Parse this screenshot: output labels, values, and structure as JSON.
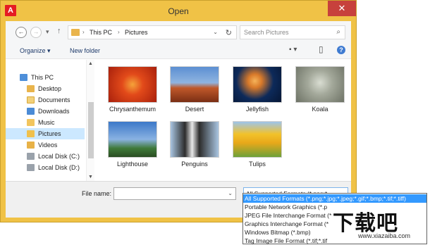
{
  "window": {
    "title": "Open",
    "app_icon_glyph": "A",
    "close_glyph": "✕",
    "titlebar_color": "#f0c246"
  },
  "nav": {
    "back_glyph": "←",
    "forward_glyph": "→",
    "recent_glyph": "▾",
    "up_glyph": "↑"
  },
  "address": {
    "crumbs": [
      "This PC",
      "Pictures"
    ],
    "sep_glyph": "›",
    "drop_glyph": "⌄",
    "refresh_glyph": "↻"
  },
  "search": {
    "placeholder": "Search Pictures",
    "icon_glyph": "⌕"
  },
  "toolbar": {
    "organize_label": "Organize ▾",
    "new_folder_label": "New folder",
    "view_glyph": "▪ ▾",
    "pane_glyph": "▯",
    "help_glyph": "?"
  },
  "sidebar": {
    "items": [
      {
        "label": "This PC",
        "icon": "computer-icon"
      },
      {
        "label": "Desktop",
        "icon": "folder-icon"
      },
      {
        "label": "Documents",
        "icon": "documents-icon"
      },
      {
        "label": "Downloads",
        "icon": "downloads-icon"
      },
      {
        "label": "Music",
        "icon": "music-icon"
      },
      {
        "label": "Pictures",
        "icon": "pictures-icon"
      },
      {
        "label": "Videos",
        "icon": "videos-icon"
      },
      {
        "label": "Local Disk (C:)",
        "icon": "disk-icon"
      },
      {
        "label": "Local Disk (D:)",
        "icon": "disk-icon"
      }
    ],
    "selected": "Pictures",
    "scroll_up_glyph": "▲",
    "scroll_down_glyph": "▼"
  },
  "files": [
    {
      "name": "Chrysanthemum",
      "colors": [
        "#e24a1a",
        "#f07a2a"
      ]
    },
    {
      "name": "Desert",
      "colors": [
        "#c0582a",
        "#5c8fd2"
      ]
    },
    {
      "name": "Jellyfish",
      "colors": [
        "#0d2a5a",
        "#d97a2a"
      ]
    },
    {
      "name": "Koala",
      "colors": [
        "#8a8f84",
        "#c9cfc0"
      ]
    },
    {
      "name": "Lighthouse",
      "colors": [
        "#3b78c8",
        "#3f7a3a"
      ]
    },
    {
      "name": "Penguins",
      "colors": [
        "#a8c4e0",
        "#2c2c2c"
      ]
    },
    {
      "name": "Tulips",
      "colors": [
        "#f2c22a",
        "#6da13a"
      ]
    }
  ],
  "filename": {
    "label": "File name:",
    "value": "",
    "drop_glyph": "⌄"
  },
  "filter": {
    "selected": "All Supported Formats (*.png;*.",
    "drop_glyph": "⌄",
    "options": [
      "All Supported Formats (*.png;*.jpg;*.jpeg;*.gif;*.bmp;*.tif;*.tiff)",
      "Portable Network Graphics (*.p",
      "JPEG File Interchange Format (*",
      "Graphics Interchange Format (*",
      "Windows Bitmap (*.bmp)",
      "Tag Image File Format (*.tif;*.tif"
    ]
  },
  "watermark": {
    "big": "下载吧",
    "url": "www.xiazaiba.com"
  }
}
